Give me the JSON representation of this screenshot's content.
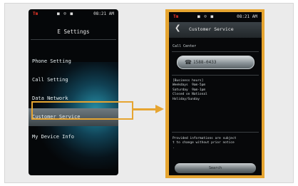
{
  "colors": {
    "highlight": "#e6a531",
    "phone_bg": "#050709",
    "carrier": "#ff3a2a"
  },
  "left_phone": {
    "status": {
      "carrier": "Tm",
      "icons": "■ ☺ ■",
      "time": "08:21 AM"
    },
    "title": "E Settings",
    "menu": [
      {
        "label": "Phone Setting",
        "selected": false
      },
      {
        "label": "Call Setting",
        "selected": false
      },
      {
        "label": "Data Network",
        "selected": false
      },
      {
        "label": "Customer Service",
        "selected": true
      },
      {
        "label": "My Device Info",
        "selected": false
      }
    ]
  },
  "right_phone": {
    "status": {
      "carrier": "Tm",
      "icons": "■ ☺ ■",
      "time": "08:21 AM"
    },
    "title": "Customer Service",
    "back_icon": "❮",
    "call_label": "Call Center",
    "phone_icon": "☎",
    "phone_number": "1588-0433",
    "hours_text": "[Business hours]\nWeekdays  9am-5pm\nSaturday  9am-1pm\nClosed on National\nHoliday/Sunday",
    "notice_text": "Provided informations are subject\nt to change without prior notice\n.",
    "search_label": "Search"
  }
}
